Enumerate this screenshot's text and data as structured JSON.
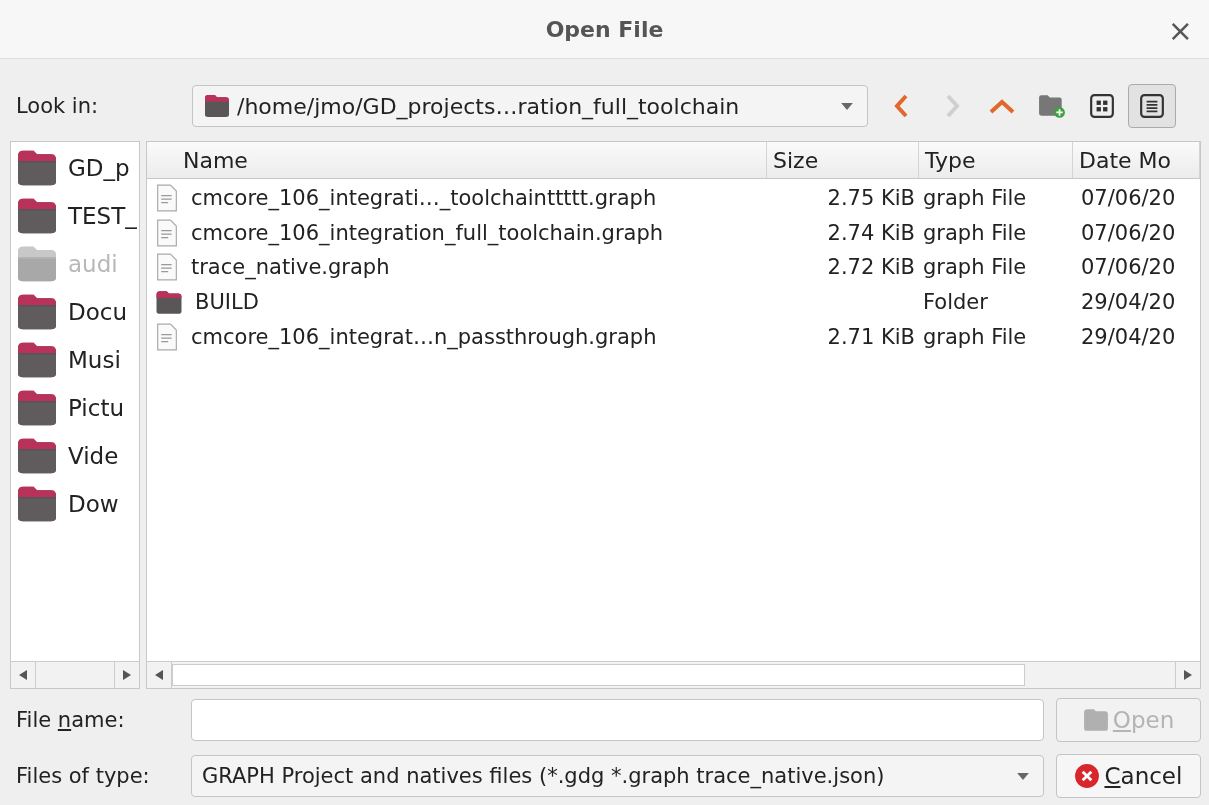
{
  "window": {
    "title": "Open File",
    "close": "×"
  },
  "look_in": {
    "label": "Look in:",
    "path": "/home/jmo/GD_projects…ration_full_toolchain"
  },
  "toolbar": [
    {
      "kind": "back",
      "disabled": false,
      "selected": false
    },
    {
      "kind": "forward",
      "disabled": true,
      "selected": false
    },
    {
      "kind": "up",
      "disabled": false,
      "selected": false
    },
    {
      "kind": "new-folder",
      "disabled": false,
      "selected": false
    },
    {
      "kind": "icon-view",
      "disabled": false,
      "selected": false
    },
    {
      "kind": "detail-view",
      "disabled": false,
      "selected": true
    }
  ],
  "sidebar": {
    "items": [
      {
        "label": "GD_p",
        "disabled": false
      },
      {
        "label": "TEST_",
        "disabled": false
      },
      {
        "label": "audi",
        "disabled": true
      },
      {
        "label": "Docu",
        "disabled": false
      },
      {
        "label": "Musi",
        "disabled": false
      },
      {
        "label": "Pictu",
        "disabled": false
      },
      {
        "label": "Vide",
        "disabled": false
      },
      {
        "label": "Dow",
        "disabled": false
      }
    ]
  },
  "table": {
    "columns": [
      "Name",
      "Size",
      "Type",
      "Date Mo"
    ],
    "rows": [
      {
        "kind": "file",
        "name": "cmcore_106_integrati…_toolchainttttt.graph",
        "size": "2.75 KiB",
        "type": "graph File",
        "date": "07/06/20"
      },
      {
        "kind": "file",
        "name": "cmcore_106_integration_full_toolchain.graph",
        "size": "2.74 KiB",
        "type": "graph File",
        "date": "07/06/20"
      },
      {
        "kind": "file",
        "name": "trace_native.graph",
        "size": "2.72 KiB",
        "type": "graph File",
        "date": "07/06/20"
      },
      {
        "kind": "folder",
        "name": "BUILD",
        "type": "Folder",
        "date": "29/04/20"
      },
      {
        "kind": "file",
        "name": "cmcore_106_integrat…n_passthrough.graph",
        "size": "2.71 KiB",
        "type": "graph File",
        "date": "29/04/20"
      }
    ]
  },
  "file_name": {
    "label": {
      "pre": "File ",
      "key": "n",
      "post": "ame:"
    }
  },
  "files_of_type": {
    "label": "Files of type:",
    "value": "GRAPH Project and natives files (*.gdg *.graph trace_native.json)"
  },
  "buttons": [
    {
      "kind": "open",
      "disabled": true,
      "label": {
        "key": "O",
        "post": "pen"
      }
    },
    {
      "kind": "cancel",
      "disabled": false,
      "label": {
        "key": "C",
        "post": "ancel"
      }
    }
  ]
}
